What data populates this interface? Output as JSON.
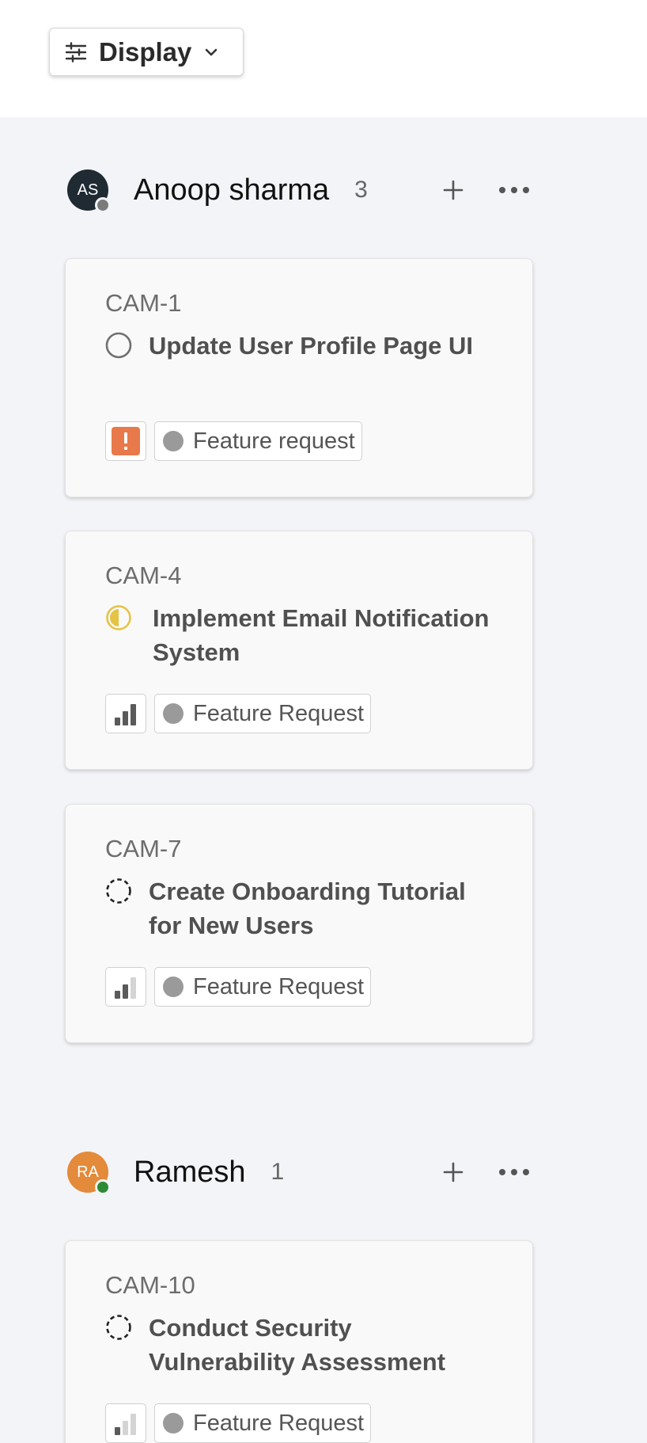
{
  "toolbar": {
    "display_label": "Display"
  },
  "groups": [
    {
      "name": "Anoop sharma",
      "initials": "AS",
      "count": "3",
      "avatar_color": "#1f2a33",
      "presence_color": "#7b7b7b",
      "cards": [
        {
          "id": "CAM-1",
          "title": "Update User Profile Page UI",
          "status": "todo-circle-icon",
          "priority": "urgent-priority-icon",
          "label": "Feature request"
        },
        {
          "id": "CAM-4",
          "title": "Implement Email Notification System",
          "status": "in-progress-half-circle-icon",
          "priority": "high-priority-bars-icon",
          "label": "Feature Request"
        },
        {
          "id": "CAM-7",
          "title": "Create Onboarding Tutorial for New Users",
          "status": "backlog-dashed-circle-icon",
          "priority": "medium-priority-bars-icon",
          "label": "Feature Request"
        }
      ]
    },
    {
      "name": "Ramesh",
      "initials": "RA",
      "count": "1",
      "avatar_color": "#e38a3b",
      "presence_color": "#2e8a34",
      "cards": [
        {
          "id": "CAM-10",
          "title": "Conduct Security Vulnerability Assessment",
          "status": "backlog-dashed-circle-icon",
          "priority": "low-priority-bars-icon",
          "label": "Feature Request"
        }
      ]
    }
  ],
  "colors": {
    "urgent": "#e8794a",
    "in_progress": "#e5c344",
    "bar_dark": "#5a5a5a",
    "bar_light": "#d4d4d4"
  }
}
